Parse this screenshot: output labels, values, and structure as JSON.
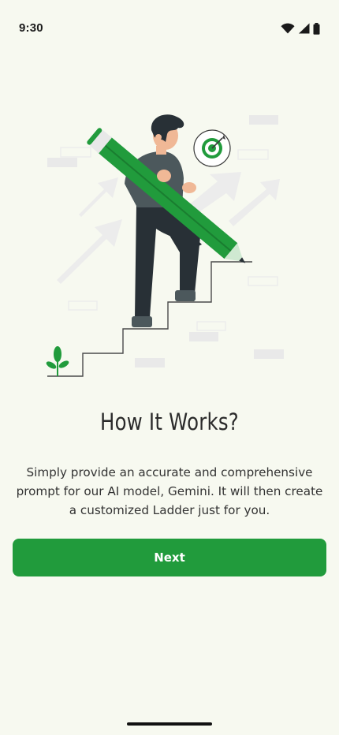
{
  "status_bar": {
    "time": "9:30",
    "icons": [
      "wifi-icon",
      "cellular-signal-icon",
      "battery-icon"
    ]
  },
  "illustration": {
    "description_name": "person-climbing-stairs-with-pencil-illustration",
    "accent_color": "#219b3c"
  },
  "onboarding": {
    "title": "How It Works?",
    "description": "Simply provide an accurate and comprehensive prompt for our AI model, Gemini. It will then create a customized Ladder just for you.",
    "next_label": "Next"
  },
  "colors": {
    "background": "#f7f9f0",
    "primary": "#219b3c",
    "text": "#2a2a2a"
  }
}
